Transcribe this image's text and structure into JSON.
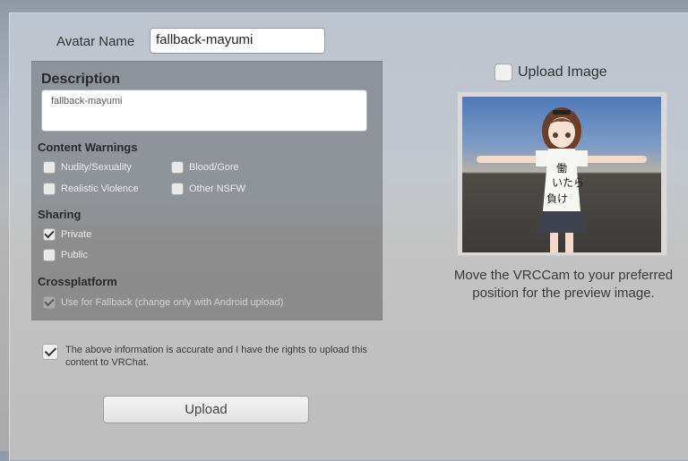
{
  "avatar_name": {
    "label": "Avatar Name",
    "value": "fallback-mayumi"
  },
  "description": {
    "title": "Description",
    "value": "fallback-mayumi"
  },
  "content_warnings": {
    "title": "Content Warnings",
    "options": [
      {
        "label": "Nudity/Sexuality",
        "checked": false
      },
      {
        "label": "Blood/Gore",
        "checked": false
      },
      {
        "label": "Realistic Violence",
        "checked": false
      },
      {
        "label": "Other NSFW",
        "checked": false
      }
    ]
  },
  "sharing": {
    "title": "Sharing",
    "options": [
      {
        "label": "Private",
        "checked": true
      },
      {
        "label": "Public",
        "checked": false
      }
    ]
  },
  "crossplatform": {
    "title": "Crossplatform",
    "option": {
      "label": "Use for Fallback (change only with Android upload)",
      "checked": true,
      "disabled": true
    }
  },
  "upload_image": {
    "label": "Upload Image",
    "checked": false
  },
  "preview": {
    "hint": "Move the VRCCam to your preferred position for the preview image."
  },
  "rights": {
    "text": "The above information is accurate and I have the rights to upload this content to VRChat.",
    "checked": true
  },
  "upload_button": {
    "label": "Upload"
  }
}
